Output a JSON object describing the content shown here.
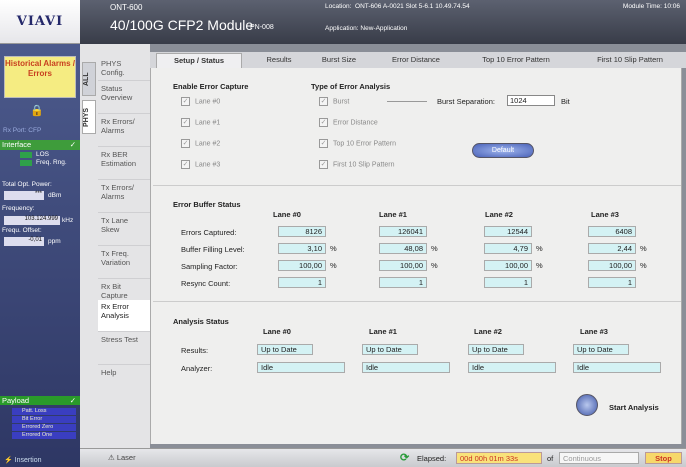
{
  "brand": "VIAVI",
  "header": {
    "device": "ONT-600",
    "module_title": "40/100G CFP2 Module",
    "part_number": "PN-008",
    "location_label": "Location:",
    "location_value": "ONT-606 A-0021   Slot 5-6.1  10.49.74.54",
    "application": "Application: New-Application",
    "module_time_label": "Module Time: 10:06"
  },
  "left_panel": {
    "historical": "Historical Alarms / Errors",
    "rx_port": "Rx Port: CFP",
    "interface": "Interface",
    "los": "LOS",
    "freq_rng": "Freq. Rng.",
    "total_opt_power": "Total Opt. Power:",
    "power_value": "***",
    "power_unit": "dBm",
    "frequency_label": "Frequency:",
    "frequency_value": "103.124.999",
    "frequency_unit": "kHz",
    "frequ_offset_label": "Frequ. Offset:",
    "offset_value": "-0,01",
    "offset_unit": "ppm",
    "payload": "Payload",
    "payload_items": [
      "Patt. Loss",
      "Bit Error",
      "Errored Zero",
      "Errored One"
    ],
    "insertion": "Insertion"
  },
  "vertical_tabs": [
    "ALL",
    "PHYS"
  ],
  "nav_items": [
    "PHYS Config.",
    "Status Overview",
    "Rx Errors/ Alarms",
    "Rx BER Estimation",
    "Tx Errors/ Alarms",
    "Tx Lane Skew",
    "Tx Freq. Variation",
    "Rx Bit Capture",
    "Rx Error Analysis",
    "Stress Test",
    "Help"
  ],
  "tabs": [
    "Setup / Status",
    "Results",
    "Burst Size",
    "Error Distance",
    "Top 10 Error Pattern",
    "First 10 Slip Pattern"
  ],
  "enable_capture": {
    "title": "Enable Error Capture",
    "lanes": [
      "Lane #0",
      "Lane #1",
      "Lane #2",
      "Lane #3"
    ]
  },
  "analysis_type": {
    "title": "Type of Error Analysis",
    "options": [
      "Burst",
      "Error Distance",
      "Top 10 Error Pattern",
      "First 10 Slip Pattern"
    ],
    "burst_separation_label": "Burst Separation:",
    "burst_separation_value": "1024",
    "burst_unit": "Bit",
    "default_button": "Default"
  },
  "buffer": {
    "title": "Error Buffer Status",
    "lanes": [
      "Lane #0",
      "Lane #1",
      "Lane #2",
      "Lane #3"
    ],
    "row_labels": [
      "Errors Captured:",
      "Buffer Filling Level:",
      "Sampling Factor:",
      "Resync Count:"
    ],
    "errors_captured": [
      "8126",
      "126041",
      "12544",
      "6408"
    ],
    "buffer_fill": [
      "3,10",
      "48,08",
      "4,79",
      "2,44"
    ],
    "sampling": [
      "100,00",
      "100,00",
      "100,00",
      "100,00"
    ],
    "resync": [
      "1",
      "1",
      "1",
      "1"
    ],
    "pct": "%"
  },
  "analysis_status": {
    "title": "Analysis Status",
    "lanes": [
      "Lane #0",
      "Lane #1",
      "Lane #2",
      "Lane #3"
    ],
    "results_label": "Results:",
    "analyzer_label": "Analyzer:",
    "results": [
      "Up to Date",
      "Up to Date",
      "Up to Date",
      "Up to Date"
    ],
    "analyzer": [
      "Idle",
      "Idle",
      "Idle",
      "Idle"
    ],
    "start_button": "Start Analysis"
  },
  "bottom": {
    "laser": "Laser",
    "elapsed_label": "Elapsed:",
    "elapsed_value": "00d 00h 01m 33s",
    "of_label": "of",
    "continuous": "Continuous",
    "stop": "Stop"
  }
}
